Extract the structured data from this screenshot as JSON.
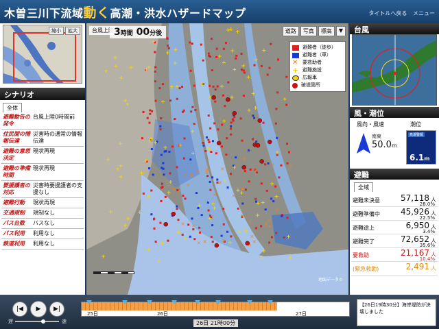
{
  "app": {
    "title_a": "木曽三川下流域",
    "title_b": "動く",
    "title_c": "高潮・洪水ハザードマップ",
    "link_top": "タイトルへ戻る",
    "link_menu": "メニュー"
  },
  "left": {
    "minimap_btn_reduce": "縮小",
    "minimap_btn_expand": "拡大",
    "scenario_title": "シナリオ",
    "tab_all": "全体",
    "items": [
      {
        "key": "避難勧告の発令",
        "value": "台風上陸0時間前"
      },
      {
        "key": "住民間の情報伝達",
        "value": "災害時の通常の情報伝達"
      },
      {
        "key": "避難の意思決定",
        "value": "現状再現"
      },
      {
        "key": "避難の準備時間",
        "value": "現状再現"
      },
      {
        "key": "要援護者の対応",
        "value": "災害時要援護者の支援なし"
      },
      {
        "key": "避難行動",
        "value": "現状再現"
      },
      {
        "key": "交通規制",
        "value": "規制なし"
      },
      {
        "key": "バス台数",
        "value": "バスなし"
      },
      {
        "key": "バス利用",
        "value": "利用なし"
      },
      {
        "key": "鉄道利用",
        "value": "利用なし"
      }
    ]
  },
  "map": {
    "time_label": "台風上陸",
    "elapsed_h": "3",
    "elapsed_h_unit": "時間",
    "elapsed_m": "00",
    "elapsed_m_unit": "分後",
    "btn_road": "道路",
    "btn_photo": "写真",
    "btn_elev": "標高",
    "btn_menu": "▼",
    "legend": [
      {
        "label": "避難者（徒歩）",
        "color": "#e02020"
      },
      {
        "label": "避難者（車）",
        "color": "#1a3ad8"
      },
      {
        "label": "要救助者",
        "color": "#f08020"
      },
      {
        "label": "避難施設",
        "color": "#f2d21a"
      },
      {
        "label": "広報車",
        "color": "#333333"
      },
      {
        "label": "破堤箇所",
        "color": "#d01010"
      }
    ],
    "credit": "地図データ©"
  },
  "right": {
    "typhoon_title": "台風",
    "wind_title": "風・潮位",
    "wind_label": "風向・風速",
    "tide_label": "潮位",
    "wind_dir": "南東",
    "wind_speed": "50.0",
    "wind_unit": "m",
    "tide_tag": "高潮警報",
    "tide_value": "6.1",
    "tide_unit": "m",
    "evac_title": "避難",
    "tab_all": "全域",
    "stats": [
      {
        "label": "避難未決意",
        "value": "57,118",
        "unit": "人",
        "pct": "28.0%"
      },
      {
        "label": "避難準備中",
        "value": "45,926",
        "unit": "人",
        "pct": "22.5%"
      },
      {
        "label": "避難途上",
        "value": "6,950",
        "unit": "人",
        "pct": "3.4%"
      },
      {
        "label": "避難完了",
        "value": "72,652",
        "unit": "人",
        "pct": "35.6%"
      },
      {
        "label": "要救助",
        "value": "21,167",
        "unit": "人",
        "pct": "10.4%"
      },
      {
        "label": "(緊急救助)",
        "value": "2,491",
        "unit": "人",
        "pct": ""
      }
    ]
  },
  "bottom": {
    "slow_label": "遅",
    "fast_label": "速",
    "date_25": "25日",
    "date_26": "26日",
    "date_27": "27日",
    "current_time": "26日 21時00分",
    "info_text": "【26日19時30分】海岸堤防が決壊しました",
    "progress": 0.73
  },
  "colors": {
    "accent": "#ffcc33",
    "danger": "#d01818",
    "water": "#a9c4e8",
    "header": "#1f4a78"
  }
}
